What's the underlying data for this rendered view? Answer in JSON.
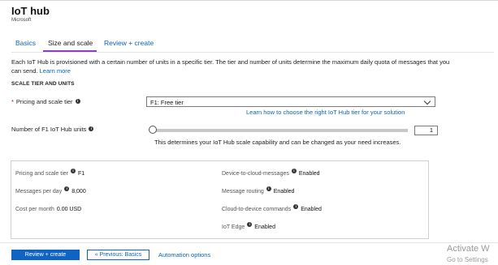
{
  "header": {
    "title": "IoT hub",
    "subtitle": "Microsoft"
  },
  "tabs": [
    {
      "label": "Basics"
    },
    {
      "label": "Size and scale",
      "selected": true
    },
    {
      "label": "Review + create"
    }
  ],
  "description": {
    "text": "Each IoT Hub is provisioned with a certain number of units in a specific tier. The tier and number of units determine the maximum daily quota of messages that you can send.",
    "learn_more": "Learn more"
  },
  "scale": {
    "section_title": "SCALE TIER AND UNITS",
    "pricing_label": "Pricing and scale tier",
    "pricing_value": "F1: Free tier",
    "tier_link": "Learn how to choose the right IoT Hub tier for your solution",
    "units_label": "Number of F1 IoT Hub units",
    "units_value": "1",
    "units_help": "This determines your IoT Hub scale capability and can be changed as your need increases.",
    "slider_level": 0
  },
  "summary": {
    "left": [
      {
        "label": "Pricing and scale tier",
        "value": "F1",
        "info": true
      },
      {
        "label": "Messages per day",
        "value": "8,000",
        "info": true
      },
      {
        "label": "Cost per month",
        "value": "0.00 USD",
        "info": false
      }
    ],
    "right": [
      {
        "label": "Device-to-cloud-messages",
        "value": "Enabled",
        "info": true
      },
      {
        "label": "Message routing",
        "value": "Enabled",
        "info": true
      },
      {
        "label": "Cloud-to-device commands",
        "value": "Enabled",
        "info": true
      },
      {
        "label": "IoT Edge",
        "value": "Enabled",
        "info": true
      }
    ]
  },
  "footer": {
    "primary_button": "Review + create",
    "secondary_button": "« Previous: Basics",
    "automation_link": "Automation options"
  },
  "watermark": {
    "line1": "Activate W",
    "line2": "Go to Settings"
  },
  "icons": {
    "info": "info-icon",
    "dropdown": "chevron-down-icon"
  },
  "colors": {
    "link": "#0a64bd",
    "primary_button": "#0f64c3",
    "tab_underline": "#8a3fc0",
    "required": "#cc0000"
  }
}
